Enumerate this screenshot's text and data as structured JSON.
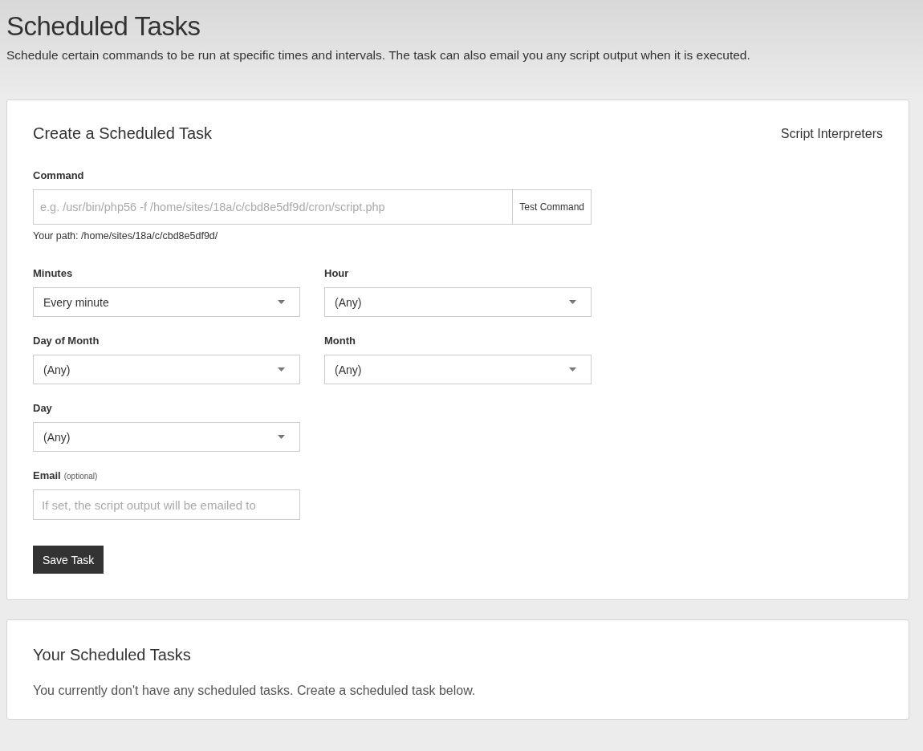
{
  "page": {
    "title": "Scheduled Tasks",
    "description": "Schedule certain commands to be run at specific times and intervals. The task can also email you any script output when it is executed."
  },
  "create_card": {
    "title": "Create a Scheduled Task",
    "link": "Script Interpreters",
    "command": {
      "label": "Command",
      "placeholder": "e.g. /usr/bin/php56 -f /home/sites/18a/c/cbd8e5df9d/cron/script.php",
      "button": "Test Command",
      "help": "Your path: /home/sites/18a/c/cbd8e5df9d/"
    },
    "selects": [
      {
        "label": "Minutes",
        "value": "Every minute"
      },
      {
        "label": "Hour",
        "value": "(Any)"
      },
      {
        "label": "Day of Month",
        "value": "(Any)"
      },
      {
        "label": "Month",
        "value": "(Any)"
      },
      {
        "label": "Day",
        "value": "(Any)"
      }
    ],
    "email": {
      "label": "Email",
      "hint": "(optional)",
      "placeholder": "If set, the script output will be emailed to"
    },
    "save_button": "Save Task"
  },
  "tasks_card": {
    "title": "Your Scheduled Tasks",
    "empty_message": "You currently don't have any scheduled tasks. Create a scheduled task below."
  }
}
